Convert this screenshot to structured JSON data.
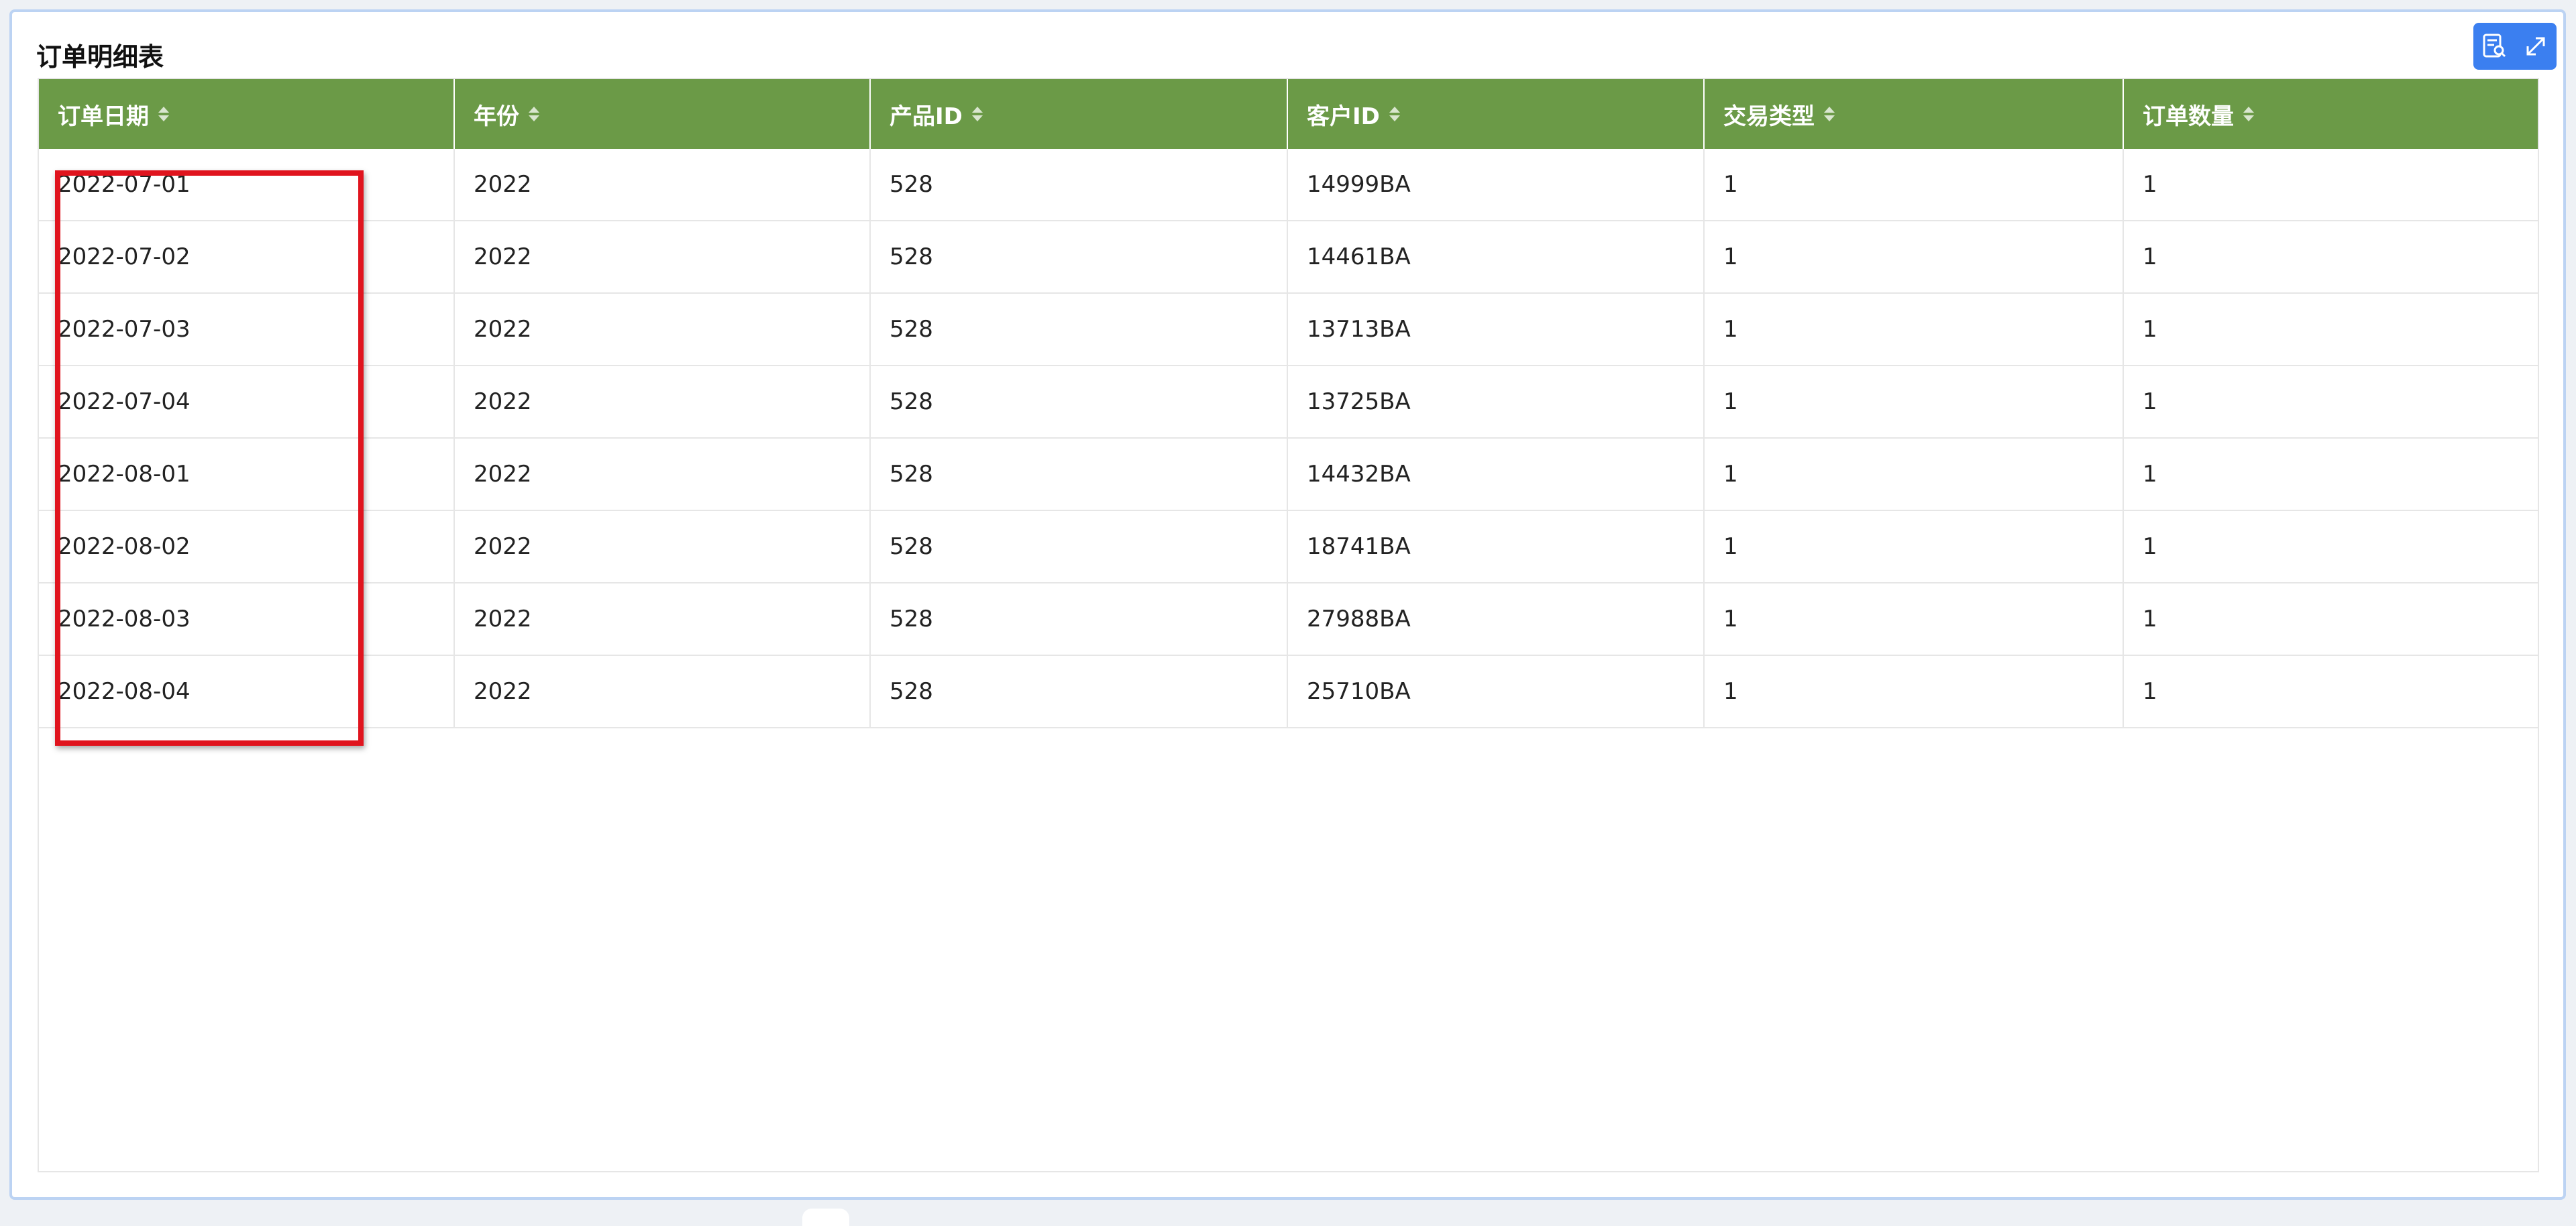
{
  "panel": {
    "title": "订单明细表"
  },
  "toolbar": {
    "icons": [
      "data-view-icon",
      "expand-icon"
    ]
  },
  "table": {
    "columns": [
      {
        "label": "订单日期"
      },
      {
        "label": "年份"
      },
      {
        "label": "产品ID"
      },
      {
        "label": "客户ID"
      },
      {
        "label": "交易类型"
      },
      {
        "label": "订单数量"
      }
    ],
    "rows": [
      [
        "2022-07-01",
        "2022",
        "528",
        "14999BA",
        "1",
        "1"
      ],
      [
        "2022-07-02",
        "2022",
        "528",
        "14461BA",
        "1",
        "1"
      ],
      [
        "2022-07-03",
        "2022",
        "528",
        "13713BA",
        "1",
        "1"
      ],
      [
        "2022-07-04",
        "2022",
        "528",
        "13725BA",
        "1",
        "1"
      ],
      [
        "2022-08-01",
        "2022",
        "528",
        "14432BA",
        "1",
        "1"
      ],
      [
        "2022-08-02",
        "2022",
        "528",
        "18741BA",
        "1",
        "1"
      ],
      [
        "2022-08-03",
        "2022",
        "528",
        "27988BA",
        "1",
        "1"
      ],
      [
        "2022-08-04",
        "2022",
        "528",
        "25710BA",
        "1",
        "1"
      ]
    ]
  },
  "colors": {
    "header_bg": "#6b9a47",
    "highlight_border": "#e0141e",
    "tool_bg": "#3b7ff0"
  }
}
